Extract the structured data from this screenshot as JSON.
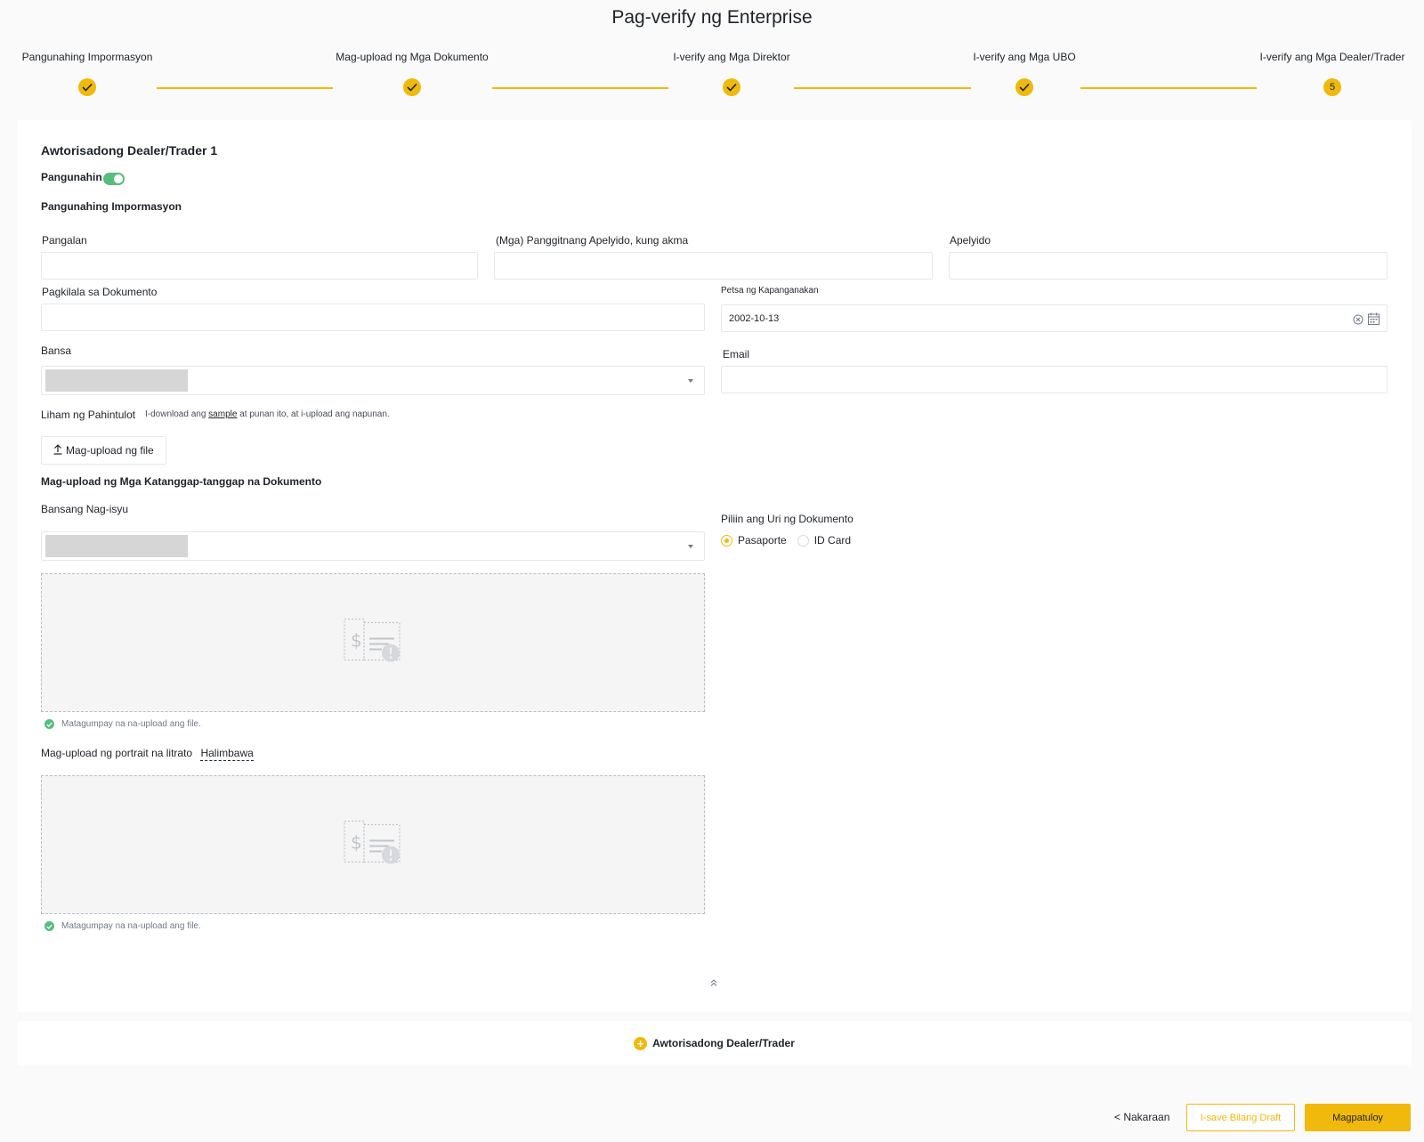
{
  "page": {
    "title": "Pag-verify ng Enterprise"
  },
  "stepper": {
    "steps": [
      {
        "label": "Pangunahing Impormasyon",
        "status": "done"
      },
      {
        "label": "Mag-upload ng Mga Dokumento",
        "status": "done"
      },
      {
        "label": "I-verify ang Mga Direktor",
        "status": "done"
      },
      {
        "label": "I-verify ang Mga UBO",
        "status": "done"
      },
      {
        "label": "I-verify ang Mga Dealer/Trader",
        "status": "current",
        "number": "5"
      }
    ],
    "accent_color": "#f0b90b"
  },
  "dealer": {
    "title": "Awtorisadong Dealer/Trader 1",
    "primary_toggle_label": "Pangunahin",
    "primary_on": true,
    "basic_info_title": "Pangunahing Impormasyon",
    "fields": {
      "first_name": {
        "label": "Pangalan",
        "value": ""
      },
      "middle_name": {
        "label": "(Mga) Panggitnang Apelyido, kung akma",
        "value": ""
      },
      "last_name": {
        "label": "Apelyido",
        "value": ""
      },
      "id_document": {
        "label": "Pagkilala sa Dokumento",
        "value": ""
      },
      "birth_date": {
        "label": "Petsa ng Kapanganakan",
        "value": "2002-10-13"
      },
      "country": {
        "label": "Bansa"
      },
      "email": {
        "label": "Email",
        "value": ""
      }
    },
    "authorization_letter": {
      "label": "Liham ng Pahintulot",
      "hint_prefix": "I-download ang",
      "hint_link": "sample",
      "hint_suffix": "at punan ito, at i-upload ang napunan.",
      "upload_button": "Mag-upload ng file"
    },
    "documents": {
      "title": "Mag-upload ng Mga Katanggap-tanggap na Dokumento",
      "issuing_country_label": "Bansang Nag-isyu",
      "doc_type_label": "Piliin ang Uri ng Dokumento",
      "doc_types": [
        {
          "label": "Pasaporte",
          "checked": true
        },
        {
          "label": "ID Card",
          "checked": false
        }
      ],
      "upload_success_1": "Matagumpay na na-upload ang file.",
      "portrait_label": "Mag-upload ng portrait na litrato",
      "portrait_example": "Halimbawa",
      "upload_success_2": "Matagumpay na na-upload ang file."
    }
  },
  "add_dealer_label": "Awtorisadong Dealer/Trader",
  "footer": {
    "back_label": "< Nakaraan",
    "save_draft_label": "I-save Bilang Draft",
    "continue_label": "Magpatuloy"
  },
  "icons": {
    "step_done": "check-icon",
    "clear": "clear-circle-icon",
    "calendar": "calendar-icon",
    "upload": "upload-icon",
    "collapse": "double-chevron-up-icon",
    "add": "plus-circle-icon",
    "success": "check-circle-icon",
    "placeholder": "document-placeholder-icon"
  }
}
